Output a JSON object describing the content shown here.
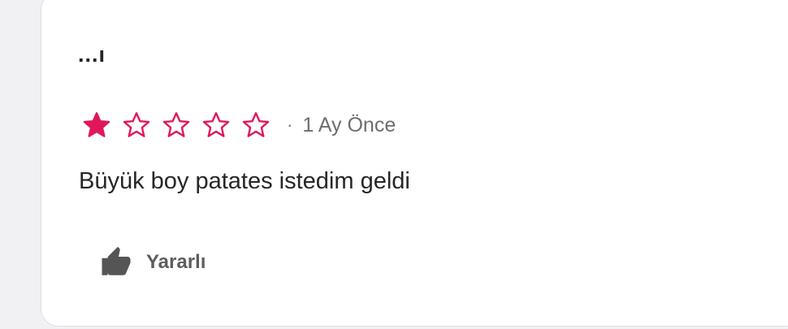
{
  "review": {
    "author": "...ı",
    "rating": 1,
    "max_rating": 5,
    "separator": "·",
    "time_ago": "1 Ay Önce",
    "text": "Büyük boy patates istedim geldi",
    "helpful_label": "Yararlı"
  },
  "icons": {
    "star": "star-icon",
    "helpful": "thumbs-up-icon"
  },
  "colors": {
    "star": "#e0185a",
    "icon": "#555555",
    "text": "#262626"
  }
}
